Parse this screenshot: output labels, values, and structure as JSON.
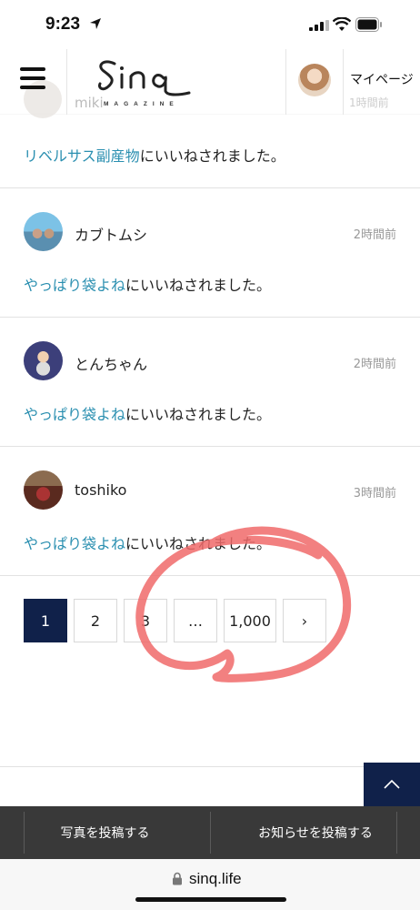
{
  "status_bar": {
    "time": "9:23"
  },
  "header": {
    "logo_text": "Sinq",
    "logo_sub": "MAGAZINE",
    "mypage_label": "マイページ",
    "peek_time": "1時間前",
    "peek_user": "miki"
  },
  "first_notification": {
    "post_title": "リベルサス副産物",
    "action_text": "にいいねされました。"
  },
  "notifications": [
    {
      "user": "カブトムシ",
      "time": "2時間前",
      "post_title": "やっぱり袋よね",
      "action_text": "にいいねされました。"
    },
    {
      "user": "とんちゃん",
      "time": "2時間前",
      "post_title": "やっぱり袋よね",
      "action_text": "にいいねされました。"
    },
    {
      "user": "toshiko",
      "time": "3時間前",
      "post_title": "やっぱり袋よね",
      "action_text": "にいいねされました。"
    }
  ],
  "pagination": {
    "current": "1",
    "pages": [
      "1",
      "2",
      "3",
      "…",
      "1,000",
      "›"
    ]
  },
  "bottom_bar": {
    "post_photo_label": "写真を投稿する",
    "post_notice_label": "お知らせを投稿する"
  },
  "browser": {
    "url": "sinq.life"
  },
  "colors": {
    "accent_navy": "#10214a",
    "link_blue": "#2a8fb0",
    "annotation_red": "#f06a6a",
    "bottom_bar": "#393939"
  }
}
